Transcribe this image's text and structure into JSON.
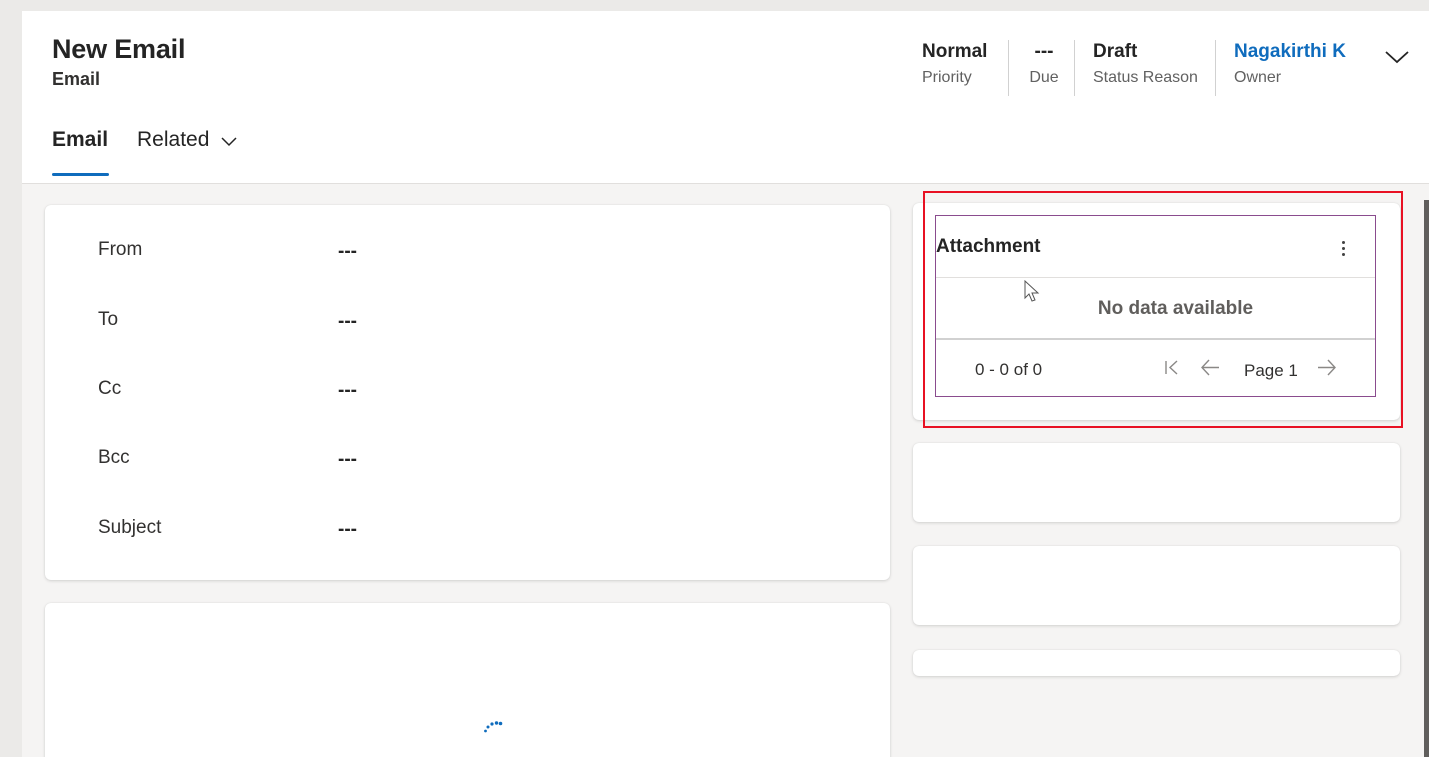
{
  "header": {
    "title": "New Email",
    "subtitle": "Email",
    "fields": [
      {
        "value": "Normal",
        "label": "Priority"
      },
      {
        "value": "---",
        "label": "Due"
      },
      {
        "value": "Draft",
        "label": "Status Reason"
      },
      {
        "value": "Nagakirthi K",
        "label": "Owner"
      }
    ],
    "expand_icon": "chevron-down-icon"
  },
  "tabs": [
    {
      "label": "Email",
      "active": true
    },
    {
      "label": "Related",
      "active": false,
      "icon": "chevron-down-icon"
    }
  ],
  "form": {
    "rows": [
      {
        "label": "From",
        "value": "---"
      },
      {
        "label": "To",
        "value": "---"
      },
      {
        "label": "Cc",
        "value": "---"
      },
      {
        "label": "Bcc",
        "value": "---"
      },
      {
        "label": "Subject",
        "value": "---"
      }
    ]
  },
  "attachment": {
    "title": "Attachment",
    "more_icon": "more-vertical-icon",
    "empty_text": "No data available",
    "range": "0 - 0 of 0",
    "page_label": "Page 1",
    "icons": [
      "first-page-icon",
      "previous-page-icon",
      "next-page-icon"
    ]
  },
  "colors": {
    "accent": "#0f6cbd",
    "highlight_border": "#e81123",
    "subgrid_border": "#8a4c8e",
    "background": "#f5f4f3"
  }
}
